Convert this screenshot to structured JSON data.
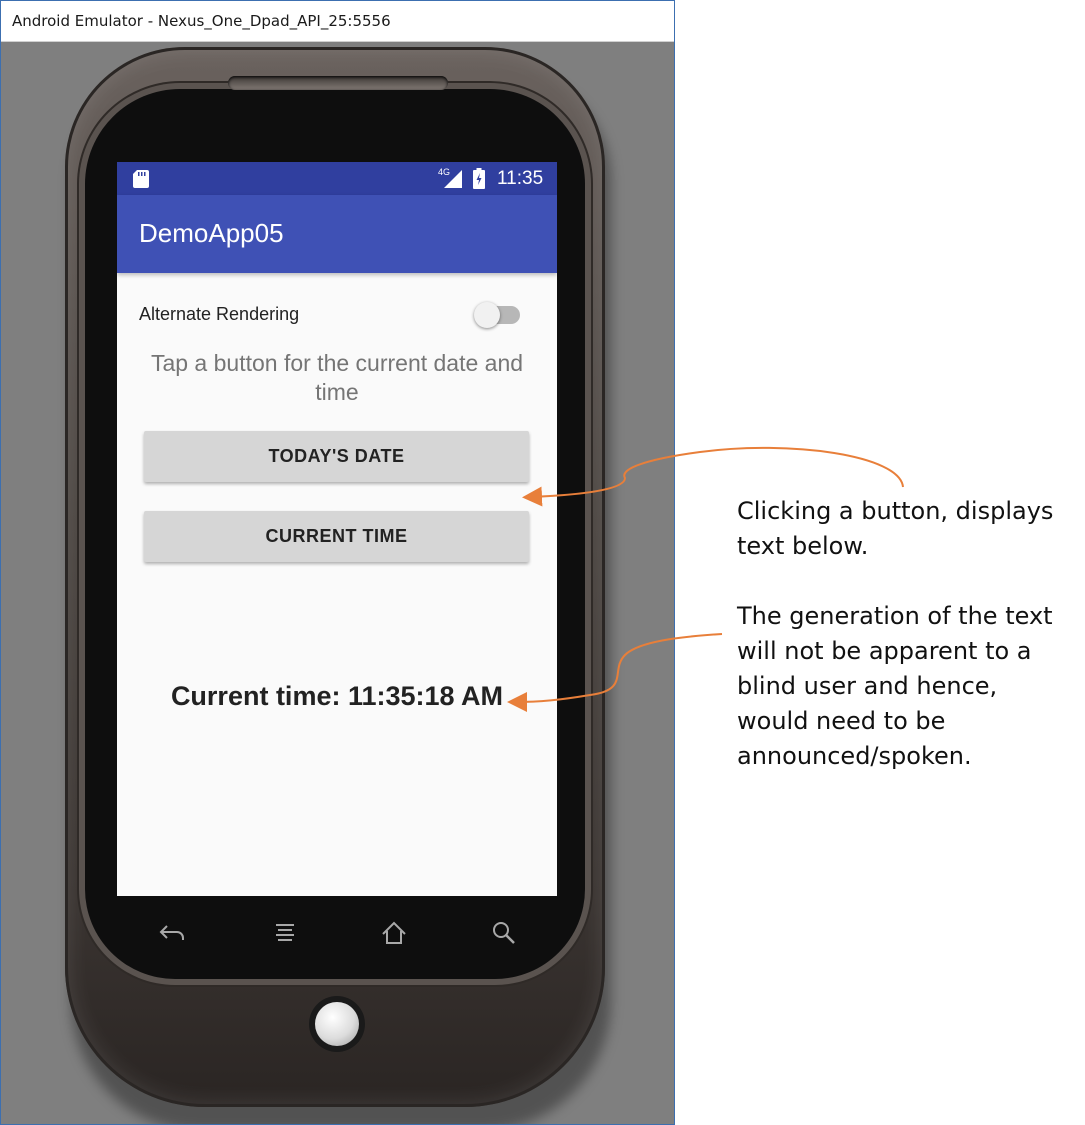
{
  "window": {
    "title": "Android Emulator - Nexus_One_Dpad_API_25:5556"
  },
  "statusbar": {
    "network": "4G",
    "time": "11:35",
    "icons": [
      "sd-card-icon",
      "signal-icon",
      "battery-icon"
    ]
  },
  "app": {
    "title": "DemoApp05",
    "switch_label": "Alternate Rendering",
    "switch_on": false,
    "prompt": "Tap a button for the current date and time",
    "date_button": "TODAY'S DATE",
    "time_button": "CURRENT TIME",
    "result": "Current time: 11:35:18 AM"
  },
  "navkeys": [
    "back-icon",
    "menu-icon",
    "home-icon",
    "search-icon"
  ],
  "annotations": {
    "note1": "Clicking a button, displays text below.",
    "note2": "The generation of the text will not be apparent to a blind user and hence, would need to be announced/spoken."
  },
  "colors": {
    "statusbar": "#303f9f",
    "appbar": "#3f51b5",
    "button": "#d6d6d6",
    "arrow": "#e87f3a",
    "emulator_bg": "#7f7f7f"
  }
}
